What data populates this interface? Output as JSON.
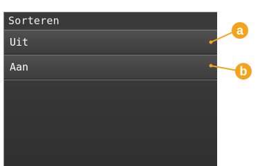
{
  "screen": {
    "title": "Sorteren",
    "items": [
      {
        "label": "Uit"
      },
      {
        "label": "Aan"
      }
    ]
  },
  "callouts": [
    {
      "letter": "a"
    },
    {
      "letter": "b"
    }
  ],
  "colors": {
    "callout": "#F7A21B",
    "panel": "#353535",
    "text": "#FFFFFF"
  }
}
